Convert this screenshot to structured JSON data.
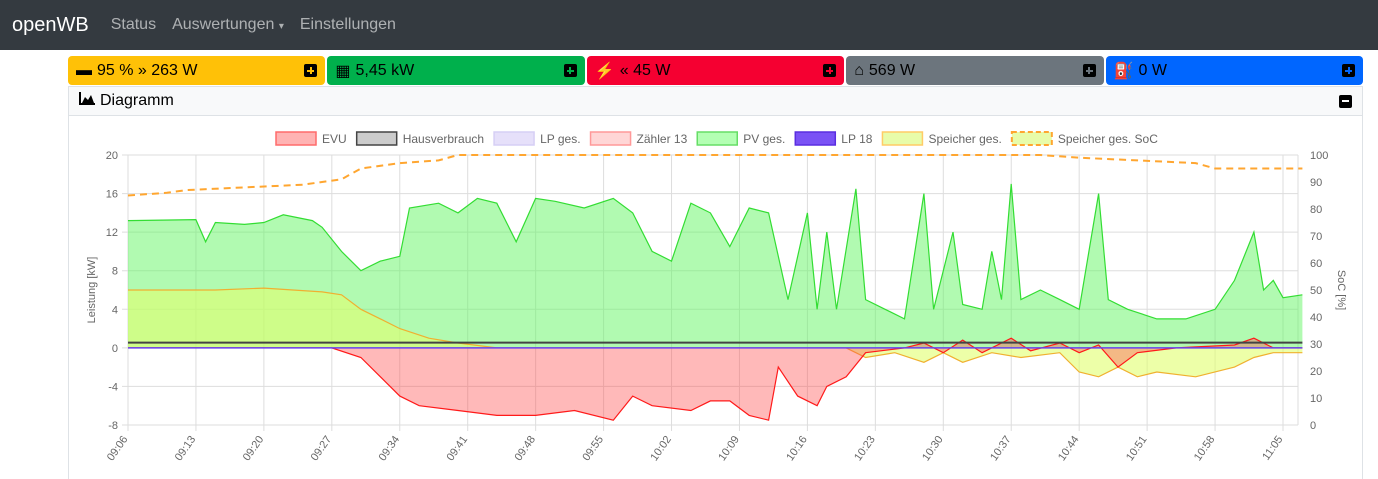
{
  "nav": {
    "brand": "openWB",
    "items": [
      "Status",
      "Auswertungen",
      "Einstellungen"
    ]
  },
  "cards": [
    {
      "name": "battery",
      "icon": "car-battery-icon",
      "text": "95 % » 263 W",
      "color": "#ffc107",
      "plus": "#ffc107"
    },
    {
      "name": "pv",
      "icon": "solar-panel-icon",
      "text": "5,45 kW",
      "color": "#00b04c",
      "plus": "#00b04c"
    },
    {
      "name": "evu",
      "icon": "power-tower-icon",
      "text": "« 45 W",
      "color": "#f50031",
      "plus": "#f50031"
    },
    {
      "name": "house",
      "icon": "home-icon",
      "text": "569 W",
      "color": "#6c757d",
      "plus": "#6c757d"
    },
    {
      "name": "charging",
      "icon": "charging-station-icon",
      "text": "0 W",
      "color": "#0066ff",
      "plus": "#0066ff"
    }
  ],
  "diagram": {
    "title": "Diagramm"
  },
  "chart_data": {
    "type": "area",
    "legend": [
      {
        "label": "EVU",
        "fill": "#ffb3b3",
        "stroke": "#ff6b6b"
      },
      {
        "label": "Hausverbrauch",
        "fill": "#cccccc",
        "stroke": "#444444"
      },
      {
        "label": "LP ges.",
        "fill": "#e6e0fa",
        "stroke": "#d6cff5"
      },
      {
        "label": "Zähler 13",
        "fill": "#ffd6d6",
        "stroke": "#ff9999"
      },
      {
        "label": "PV ges.",
        "fill": "#b3ffb3",
        "stroke": "#66dd66"
      },
      {
        "label": "LP 18",
        "fill": "#7a52f5",
        "stroke": "#5a2ee0"
      },
      {
        "label": "Speicher ges.",
        "fill": "#e8fcaa",
        "stroke": "#ffcc66"
      },
      {
        "label": "Speicher ges. SoC",
        "fill": "#e8fcaa",
        "stroke": "#ffa630",
        "dashed": true
      }
    ],
    "ylabel": "Leistung [kW]",
    "y2label": "SoC [%]",
    "ylim": [
      -8,
      20
    ],
    "yticks": [
      20,
      16,
      12,
      8,
      4,
      0,
      -4,
      -8
    ],
    "y2lim": [
      0,
      100
    ],
    "y2ticks": [
      100,
      90,
      80,
      70,
      60,
      50,
      40,
      30,
      20,
      10,
      0
    ],
    "xticks": [
      "09:06",
      "09:13",
      "09:20",
      "09:27",
      "09:34",
      "09:41",
      "09:48",
      "09:55",
      "10:02",
      "10:09",
      "10:16",
      "10:23",
      "10:30",
      "10:37",
      "10:44",
      "10:51",
      "10:58",
      "11:05"
    ],
    "series": {
      "pv": [
        [
          "09:06",
          13.2
        ],
        [
          "09:13",
          13.3
        ],
        [
          "09:14",
          11
        ],
        [
          "09:15",
          13
        ],
        [
          "09:18",
          12.8
        ],
        [
          "09:20",
          13
        ],
        [
          "09:22",
          13.8
        ],
        [
          "09:25",
          13.2
        ],
        [
          "09:26",
          12.5
        ],
        [
          "09:28",
          10
        ],
        [
          "09:30",
          8
        ],
        [
          "09:32",
          9
        ],
        [
          "09:34",
          9.5
        ],
        [
          "09:35",
          14.5
        ],
        [
          "09:38",
          15
        ],
        [
          "09:40",
          14
        ],
        [
          "09:42",
          15.5
        ],
        [
          "09:44",
          15
        ],
        [
          "09:46",
          11
        ],
        [
          "09:48",
          15.5
        ],
        [
          "09:50",
          15.2
        ],
        [
          "09:53",
          14.5
        ],
        [
          "09:56",
          15.5
        ],
        [
          "09:58",
          14
        ],
        [
          "10:00",
          10
        ],
        [
          "10:02",
          9
        ],
        [
          "10:04",
          15
        ],
        [
          "10:06",
          14
        ],
        [
          "10:08",
          10.5
        ],
        [
          "10:10",
          14.5
        ],
        [
          "10:12",
          14
        ],
        [
          "10:14",
          5
        ],
        [
          "10:16",
          14
        ],
        [
          "10:17",
          4
        ],
        [
          "10:18",
          12
        ],
        [
          "10:19",
          4
        ],
        [
          "10:21",
          16.5
        ],
        [
          "10:22",
          5
        ],
        [
          "10:24",
          4
        ],
        [
          "10:26",
          3
        ],
        [
          "10:28",
          16
        ],
        [
          "10:29",
          4
        ],
        [
          "10:31",
          12
        ],
        [
          "10:32",
          4.5
        ],
        [
          "10:34",
          4
        ],
        [
          "10:35",
          10
        ],
        [
          "10:36",
          5
        ],
        [
          "10:37",
          17
        ],
        [
          "10:38",
          5
        ],
        [
          "10:40",
          6
        ],
        [
          "10:42",
          5
        ],
        [
          "10:44",
          4
        ],
        [
          "10:46",
          16
        ],
        [
          "10:47",
          5
        ],
        [
          "10:49",
          4
        ],
        [
          "10:52",
          3
        ],
        [
          "10:55",
          3
        ],
        [
          "10:58",
          4
        ],
        [
          "11:00",
          7
        ],
        [
          "11:02",
          12
        ],
        [
          "11:03",
          6
        ],
        [
          "11:04",
          7
        ],
        [
          "11:05",
          5.2
        ],
        [
          "11:07",
          5.5
        ]
      ],
      "speicher": [
        [
          "09:06",
          6
        ],
        [
          "09:15",
          6
        ],
        [
          "09:20",
          6.2
        ],
        [
          "09:26",
          5.8
        ],
        [
          "09:28",
          5.5
        ],
        [
          "09:30",
          4
        ],
        [
          "09:32",
          3
        ],
        [
          "09:34",
          2
        ],
        [
          "09:37",
          1
        ],
        [
          "09:40",
          0.5
        ],
        [
          "09:44",
          0
        ],
        [
          "10:20",
          0
        ],
        [
          "10:22",
          -1
        ],
        [
          "10:25",
          -0.5
        ],
        [
          "10:28",
          -1.5
        ],
        [
          "10:30",
          -0.5
        ],
        [
          "10:32",
          -1.5
        ],
        [
          "10:35",
          -0.5
        ],
        [
          "10:38",
          -1
        ],
        [
          "10:42",
          -0.5
        ],
        [
          "10:44",
          -2.5
        ],
        [
          "10:46",
          -3
        ],
        [
          "10:48",
          -2
        ],
        [
          "10:50",
          -3
        ],
        [
          "10:52",
          -2.5
        ],
        [
          "10:56",
          -3
        ],
        [
          "11:00",
          -2
        ],
        [
          "11:02",
          -1
        ],
        [
          "11:04",
          -0.5
        ],
        [
          "11:07",
          -0.5
        ]
      ],
      "evu": [
        [
          "09:06",
          0
        ],
        [
          "09:27",
          0
        ],
        [
          "09:30",
          -1
        ],
        [
          "09:32",
          -3
        ],
        [
          "09:34",
          -5
        ],
        [
          "09:36",
          -6
        ],
        [
          "09:40",
          -6.5
        ],
        [
          "09:44",
          -7
        ],
        [
          "09:48",
          -7
        ],
        [
          "09:52",
          -6.5
        ],
        [
          "09:56",
          -7.5
        ],
        [
          "09:58",
          -5
        ],
        [
          "10:00",
          -6
        ],
        [
          "10:04",
          -6.5
        ],
        [
          "10:06",
          -5.5
        ],
        [
          "10:08",
          -5.5
        ],
        [
          "10:10",
          -7
        ],
        [
          "10:12",
          -7.5
        ],
        [
          "10:13",
          -2
        ],
        [
          "10:15",
          -5
        ],
        [
          "10:17",
          -6
        ],
        [
          "10:18",
          -4
        ],
        [
          "10:20",
          -3
        ],
        [
          "10:22",
          -0.5
        ],
        [
          "10:26",
          0
        ],
        [
          "10:28",
          0.5
        ],
        [
          "10:30",
          -0.5
        ],
        [
          "10:32",
          0.8
        ],
        [
          "10:34",
          -0.5
        ],
        [
          "10:37",
          1
        ],
        [
          "10:39",
          -0.3
        ],
        [
          "10:42",
          0.5
        ],
        [
          "10:44",
          -0.5
        ],
        [
          "10:46",
          0.3
        ],
        [
          "10:48",
          -2
        ],
        [
          "10:50",
          -0.5
        ],
        [
          "10:54",
          0
        ],
        [
          "11:00",
          0.3
        ],
        [
          "11:02",
          1
        ],
        [
          "11:04",
          0
        ],
        [
          "11:07",
          0
        ]
      ],
      "haus": [
        [
          "09:06",
          0.55
        ],
        [
          "11:07",
          0.55
        ]
      ],
      "lp": [
        [
          "09:06",
          0
        ],
        [
          "11:07",
          0
        ]
      ],
      "soc": [
        [
          "09:06",
          85
        ],
        [
          "09:10",
          86
        ],
        [
          "09:12",
          87
        ],
        [
          "09:18",
          88
        ],
        [
          "09:24",
          89
        ],
        [
          "09:28",
          91
        ],
        [
          "09:30",
          95
        ],
        [
          "09:34",
          97
        ],
        [
          "09:38",
          98
        ],
        [
          "09:40",
          100
        ],
        [
          "10:40",
          100
        ],
        [
          "10:44",
          99
        ],
        [
          "10:50",
          98
        ],
        [
          "10:56",
          97
        ],
        [
          "10:58",
          95
        ],
        [
          "11:07",
          95
        ]
      ]
    }
  }
}
